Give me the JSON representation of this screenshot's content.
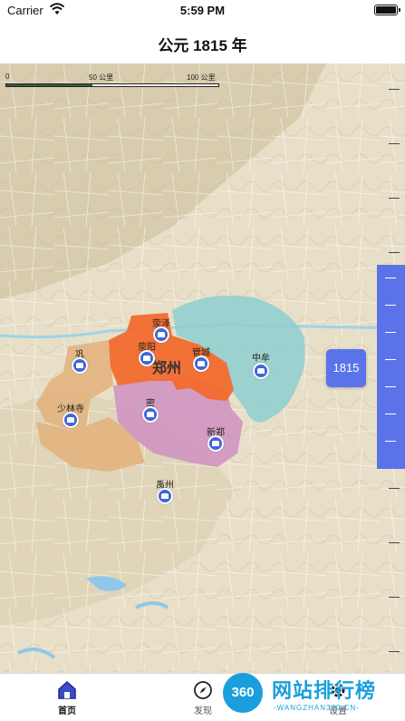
{
  "status": {
    "carrier": "Carrier",
    "time": "5:59 PM"
  },
  "header": {
    "title": "公元 1815 年"
  },
  "map": {
    "scale": {
      "zero": "0",
      "mid": "50 公里",
      "max": "100 公里"
    },
    "region_label": "郑州",
    "places": [
      {
        "name": "荥泽"
      },
      {
        "name": "荥阳"
      },
      {
        "name": "巩"
      },
      {
        "name": "管城"
      },
      {
        "name": "中牟"
      },
      {
        "name": "少林寺"
      },
      {
        "name": "密"
      },
      {
        "name": "新郑"
      },
      {
        "name": "禹州"
      }
    ],
    "colors": {
      "zhengzhou": "#f26a2e",
      "zhongmou": "#8fcfcf",
      "gong": "#e2b47e",
      "mi": "#cf95c2",
      "slider": "#5b73e8",
      "pin": "#3f67d8"
    }
  },
  "timeline": {
    "year": "1815"
  },
  "tabbar": {
    "home": "首页",
    "discover": "发现",
    "settings": "设置"
  },
  "watermark": {
    "logo": "360",
    "text": "网站排行榜",
    "sub": "-WANGZHAN360.CN-"
  }
}
